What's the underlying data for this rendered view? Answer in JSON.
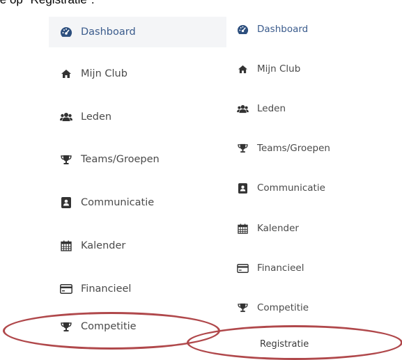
{
  "caption": "je op \"Registratie\".",
  "left_menu": {
    "items": [
      {
        "label": "Dashboard",
        "icon": "dashboard-icon"
      },
      {
        "label": "Mijn Club",
        "icon": "home-icon"
      },
      {
        "label": "Leden",
        "icon": "users-icon"
      },
      {
        "label": "Teams/Groepen",
        "icon": "trophy-icon"
      },
      {
        "label": "Communicatie",
        "icon": "contact-card-icon"
      },
      {
        "label": "Kalender",
        "icon": "calendar-icon"
      },
      {
        "label": "Financieel",
        "icon": "credit-card-icon"
      },
      {
        "label": "Competitie",
        "icon": "trophy-icon"
      }
    ]
  },
  "right_menu": {
    "items": [
      {
        "label": "Dashboard",
        "icon": "dashboard-icon"
      },
      {
        "label": "Mijn Club",
        "icon": "home-icon"
      },
      {
        "label": "Leden",
        "icon": "users-icon"
      },
      {
        "label": "Teams/Groepen",
        "icon": "trophy-icon"
      },
      {
        "label": "Communicatie",
        "icon": "contact-card-icon"
      },
      {
        "label": "Kalender",
        "icon": "calendar-icon"
      },
      {
        "label": "Financieel",
        "icon": "credit-card-icon"
      },
      {
        "label": "Competitie",
        "icon": "trophy-icon"
      }
    ],
    "submenu": {
      "label": "Registratie"
    }
  },
  "colors": {
    "accent": "#3a5b8c",
    "highlight": "#b0484b",
    "active_bg": "#f4f5f7"
  }
}
